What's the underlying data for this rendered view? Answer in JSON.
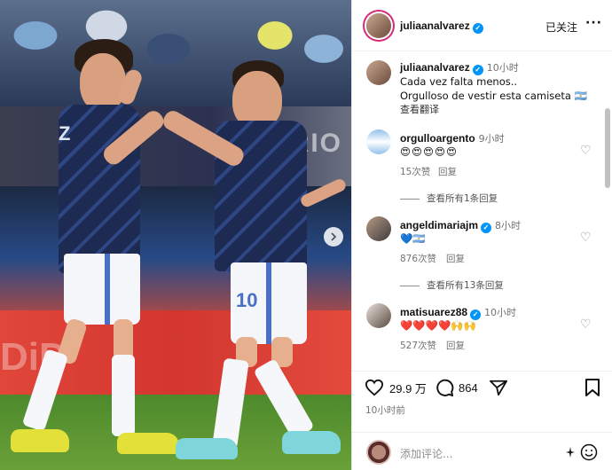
{
  "photo": {
    "banner_text": "ARIO",
    "ad_text": "DiD",
    "jersey_number_right": "10",
    "jersey_number_left": "Z",
    "next_icon": "chevron-right-icon"
  },
  "post": {
    "author": "juliaanalvarez",
    "follow_label": "已关注",
    "more_label": "···",
    "caption_user": "juliaanalvarez",
    "caption_time": "10小时",
    "caption_line1": "Cada vez falta menos..",
    "caption_line2": "Orgulloso de vestir esta camiseta 🇦🇷",
    "translate_label": "查看翻译"
  },
  "comments": [
    {
      "user": "orgulloargento",
      "time": "9小时",
      "verified": false,
      "emojis": "😍😍😍😍😍",
      "likes": "15次赞",
      "reply": "回复",
      "view_replies": "查看所有1条回复"
    },
    {
      "user": "angeldimariajm",
      "time": "8小时",
      "verified": true,
      "emojis": "💙🇦🇷",
      "likes": "876次赞",
      "reply": "回复",
      "view_replies": "查看所有13条回复"
    },
    {
      "user": "matisuarez88",
      "time": "10小时",
      "verified": true,
      "emojis": "❤️❤️❤️❤️🙌🙌",
      "likes": "527次赞",
      "reply": "回复"
    }
  ],
  "actions": {
    "likes": "29.9 万",
    "comments": "864",
    "time": "10小时前"
  },
  "add_comment": {
    "placeholder": "添加评论..."
  },
  "colors": {
    "verified": "#0095f6",
    "muted": "#737373",
    "jersey": "#1d2a52"
  }
}
